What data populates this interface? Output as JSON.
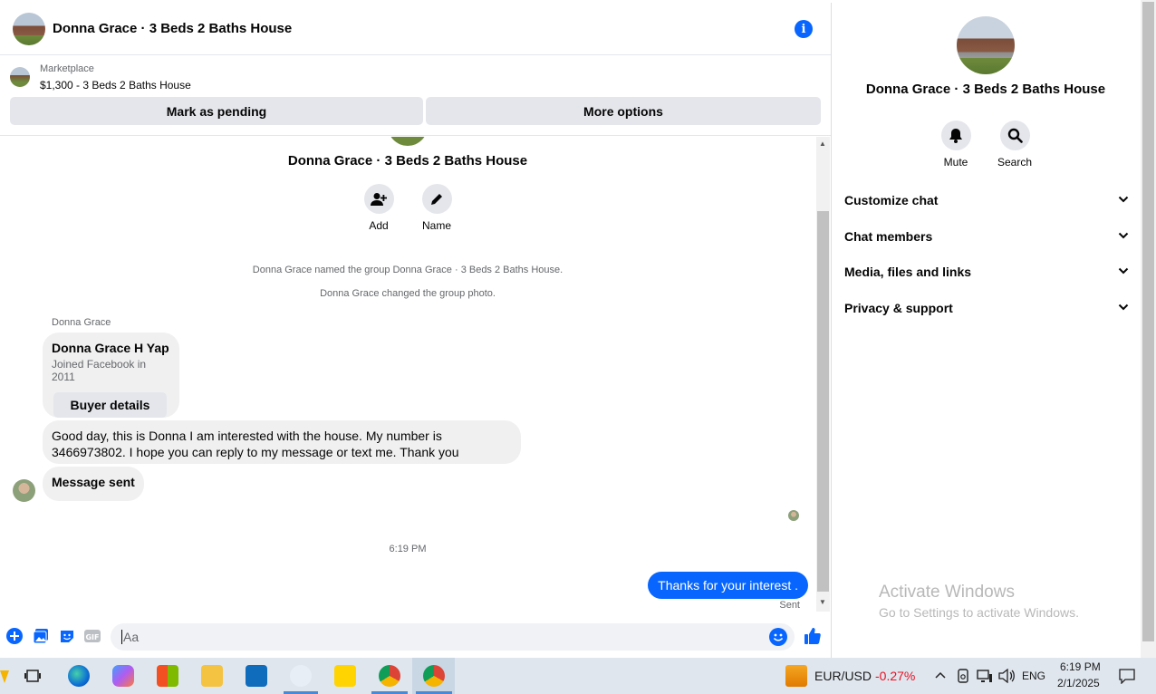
{
  "header": {
    "title": "Donna Grace · 3 Beds 2 Baths House"
  },
  "marketplace": {
    "label": "Marketplace",
    "listing": "$1,300 - 3 Beds 2 Baths House",
    "pending_button": "Mark as pending",
    "more_button": "More options"
  },
  "conversation": {
    "group_name": "Donna Grace · 3 Beds 2 Baths House",
    "actions": {
      "add": "Add",
      "name": "Name"
    },
    "system_messages": [
      "Donna Grace named the group Donna Grace · 3 Beds 2 Baths House.",
      "Donna Grace changed the group photo."
    ],
    "sender": "Donna Grace",
    "card": {
      "name": "Donna Grace H Yap",
      "subtitle": "Joined Facebook in 2011",
      "button": "Buyer details"
    },
    "messages_in": [
      "Good day, this is Donna I am interested with the house. My number is 3466973802. I hope you can reply to my message or text me. Thank you",
      "Message sent"
    ],
    "timestamp": "6:19 PM",
    "message_out": "Thanks for your interest .",
    "status": "Sent"
  },
  "composer": {
    "placeholder": "Aa"
  },
  "info_panel": {
    "name": "Donna Grace · 3 Beds 2 Baths House",
    "mute": "Mute",
    "search": "Search",
    "sections": [
      "Customize chat",
      "Chat members",
      "Media, files and links",
      "Privacy & support"
    ]
  },
  "watermark": {
    "line1": "Activate Windows",
    "line2": "Go to Settings to activate Windows."
  },
  "taskbar": {
    "ticker": "EUR/USD",
    "change": "-0.27%",
    "language": "ENG",
    "time": "6:19 PM",
    "date": "2/1/2025"
  },
  "colors": {
    "accent": "#0866ff",
    "negative": "#e81123"
  }
}
